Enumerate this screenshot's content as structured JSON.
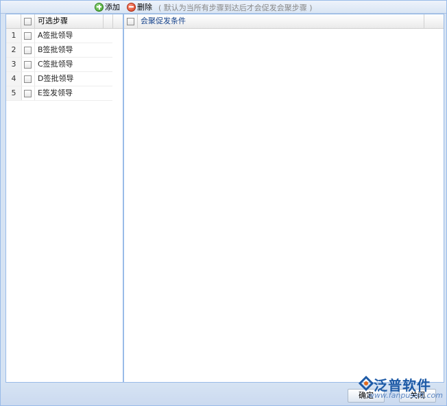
{
  "toolbar": {
    "add_label": "添加",
    "delete_label": "删除",
    "hint": "( 默认为当所有步骤到达后才会促发会聚步骤 )"
  },
  "left_grid": {
    "header": "可选步骤",
    "rows": [
      {
        "num": "1",
        "label": "A签批领导"
      },
      {
        "num": "2",
        "label": "B签批领导"
      },
      {
        "num": "3",
        "label": "C签批领导"
      },
      {
        "num": "4",
        "label": "D签批领导"
      },
      {
        "num": "5",
        "label": "E签发领导"
      }
    ]
  },
  "right_grid": {
    "header": "会聚促发条件"
  },
  "footer": {
    "ok_label": "确定",
    "close_label": "关闭"
  },
  "watermark": {
    "brand": "泛普软件",
    "url": "www.fanpusoft.com"
  }
}
